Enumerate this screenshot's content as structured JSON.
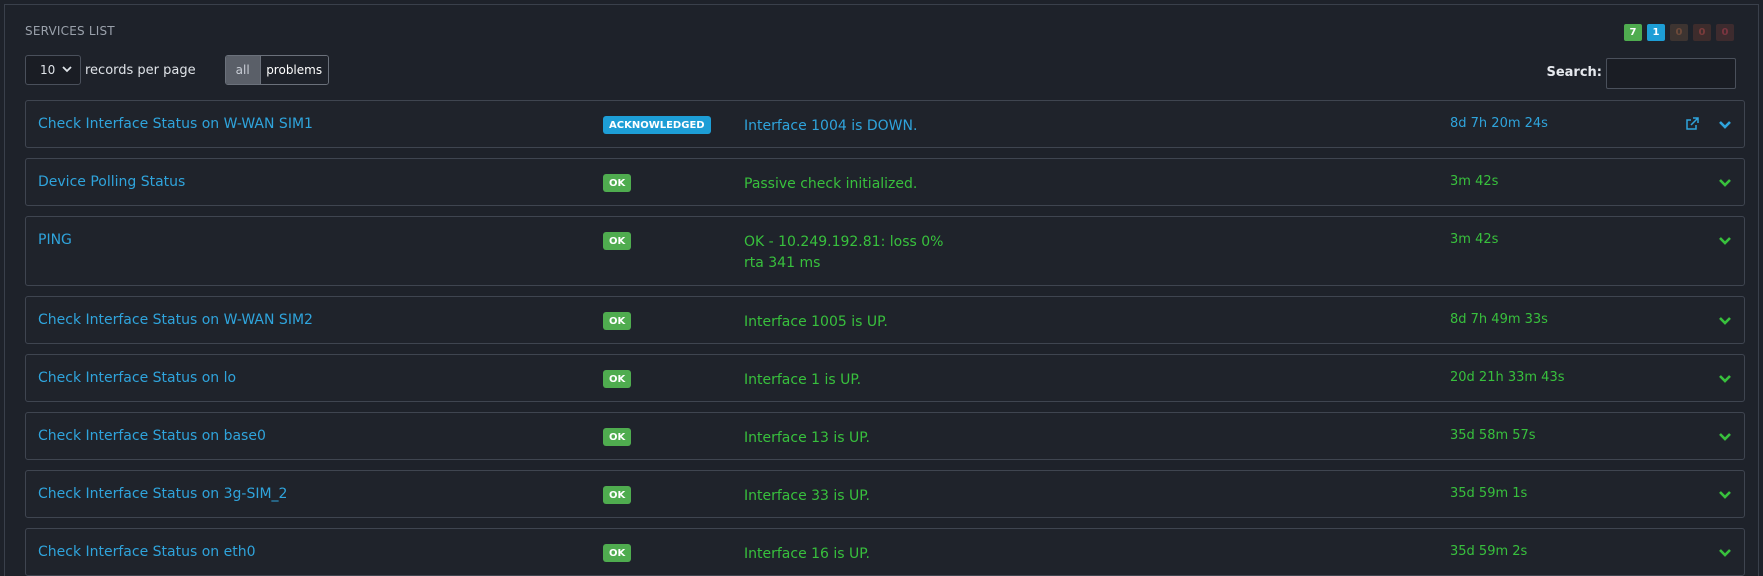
{
  "panel": {
    "title": "SERVICES LIST",
    "badges": [
      {
        "name": "ok",
        "count": "7",
        "color": "#4fac4f"
      },
      {
        "name": "acknowledged",
        "count": "1",
        "color": "#1d9ed6"
      },
      {
        "name": "warning",
        "count": "0",
        "color": "#3d3431"
      },
      {
        "name": "critical",
        "count": "0",
        "color": "#3d2c2c"
      },
      {
        "name": "unknown",
        "count": "0",
        "color": "#3d2b2e"
      }
    ]
  },
  "toolbar": {
    "page_size": "10",
    "records_label": "records per page",
    "filter_all": "all",
    "filter_problems": "problems",
    "search_label": "Search:",
    "search_value": ""
  },
  "services": [
    {
      "name": "Check Interface Status on W-WAN SIM1",
      "state": "ACKNOWLEDGED",
      "output": "Interface 1004 is DOWN.",
      "output_line2": "",
      "duration": "8d 7h 20m 24s"
    },
    {
      "name": "Device Polling Status",
      "state": "OK",
      "output": "Passive check initialized.",
      "output_line2": "",
      "duration": "3m 42s"
    },
    {
      "name": "PING",
      "state": "OK",
      "output": "OK - 10.249.192.81: loss 0%",
      "output_line2": "rta 341 ms",
      "duration": "3m 42s"
    },
    {
      "name": "Check Interface Status on W-WAN SIM2",
      "state": "OK",
      "output": "Interface 1005 is UP.",
      "output_line2": "",
      "duration": "8d 7h 49m 33s"
    },
    {
      "name": "Check Interface Status on lo",
      "state": "OK",
      "output": "Interface 1 is UP.",
      "output_line2": "",
      "duration": "20d 21h 33m 43s"
    },
    {
      "name": "Check Interface Status on base0",
      "state": "OK",
      "output": "Interface 13 is UP.",
      "output_line2": "",
      "duration": "35d 58m 57s"
    },
    {
      "name": "Check Interface Status on 3g-SIM_2",
      "state": "OK",
      "output": "Interface 33 is UP.",
      "output_line2": "",
      "duration": "35d 59m 1s"
    },
    {
      "name": "Check Interface Status on eth0",
      "state": "OK",
      "output": "Interface 16 is UP.",
      "output_line2": "",
      "duration": "35d 59m 2s"
    }
  ],
  "colors": {
    "ok_green": "#38c03d",
    "link_blue": "#2fa4dc",
    "ack_blue": "#1d9ed6",
    "background": "#1e222a"
  },
  "icons": {
    "expand": "chevron-down-icon",
    "external": "external-link-icon",
    "select_caret": "chevron-down-icon"
  }
}
